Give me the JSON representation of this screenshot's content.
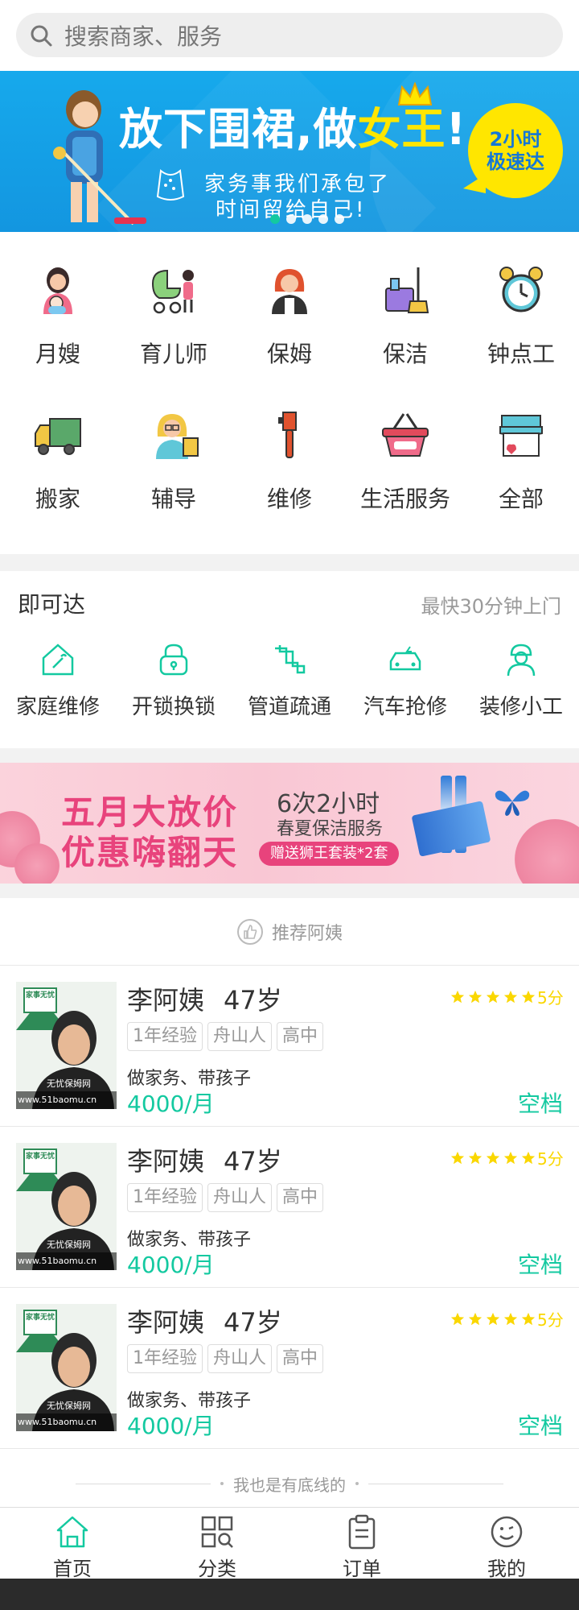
{
  "search": {
    "placeholder": "搜索商家、服务"
  },
  "banner": {
    "headline_prefix": "放下围裙,做",
    "headline_highlight": "女王",
    "headline_suffix": "!",
    "badge_line1": "2小时",
    "badge_line2": "极速达",
    "subtitle1": "家务事我们承包了",
    "subtitle2": "时间留给自己!",
    "dots_total": 5,
    "active_dot": 1
  },
  "categories": [
    {
      "label": "月嫂",
      "icon": "mother-baby-icon"
    },
    {
      "label": "育儿师",
      "icon": "stroller-icon"
    },
    {
      "label": "保姆",
      "icon": "nanny-icon"
    },
    {
      "label": "保洁",
      "icon": "cleaning-bucket-icon"
    },
    {
      "label": "钟点工",
      "icon": "alarm-clock-icon"
    },
    {
      "label": "搬家",
      "icon": "moving-truck-icon"
    },
    {
      "label": "辅导",
      "icon": "tutor-icon"
    },
    {
      "label": "维修",
      "icon": "wrench-icon"
    },
    {
      "label": "生活服务",
      "icon": "basket-icon"
    },
    {
      "label": "全部",
      "icon": "store-icon"
    }
  ],
  "quick": {
    "title": "即可达",
    "note": "最快30分钟上门",
    "items": [
      {
        "label": "家庭维修",
        "icon": "house-wrench-icon"
      },
      {
        "label": "开锁换锁",
        "icon": "lock-icon"
      },
      {
        "label": "管道疏通",
        "icon": "pipe-icon"
      },
      {
        "label": "汽车抢修",
        "icon": "car-icon"
      },
      {
        "label": "装修小工",
        "icon": "worker-icon"
      }
    ]
  },
  "promo": {
    "title1": "五月大放价",
    "title2": "优惠嗨翻天",
    "line1": "6次2小时",
    "line2": "春夏保洁服务",
    "line3": "赠送狮王套装*2套"
  },
  "recommend": {
    "title": "推荐阿姨",
    "cards": [
      {
        "name": "李阿姨",
        "age": "47岁",
        "tags": [
          "1年经验",
          "舟山人",
          "高中"
        ],
        "duties": "做家务、带孩子",
        "salary": "4000/月",
        "score": "5分",
        "rating": 5,
        "status": "空档",
        "photo_text": "无忧保姆网",
        "photo_url": "www.51baomu.cn",
        "photo_badge": "家事无忧"
      },
      {
        "name": "李阿姨",
        "age": "47岁",
        "tags": [
          "1年经验",
          "舟山人",
          "高中"
        ],
        "duties": "做家务、带孩子",
        "salary": "4000/月",
        "score": "5分",
        "rating": 5,
        "status": "空档",
        "photo_text": "无忧保姆网",
        "photo_url": "www.51baomu.cn",
        "photo_badge": "家事无忧"
      },
      {
        "name": "李阿姨",
        "age": "47岁",
        "tags": [
          "1年经验",
          "舟山人",
          "高中"
        ],
        "duties": "做家务、带孩子",
        "salary": "4000/月",
        "score": "5分",
        "rating": 5,
        "status": "空档",
        "photo_text": "无忧保姆网",
        "photo_url": "www.51baomu.cn",
        "photo_badge": "家事无忧"
      }
    ]
  },
  "footer_note": "我也是有底线的",
  "tabs": [
    {
      "label": "首页",
      "icon": "home-icon",
      "active": true
    },
    {
      "label": "分类",
      "icon": "category-grid-icon",
      "active": false
    },
    {
      "label": "订单",
      "icon": "order-clipboard-icon",
      "active": false
    },
    {
      "label": "我的",
      "icon": "profile-face-icon",
      "active": false
    }
  ],
  "colors": {
    "accent": "#13c9a0",
    "search_bg": "#eeeeee",
    "placeholder": "#767676",
    "muted": "#9a9a9a",
    "tag_text": "#999999",
    "star": "#fad700",
    "banner_blue": "#16a9ec"
  }
}
